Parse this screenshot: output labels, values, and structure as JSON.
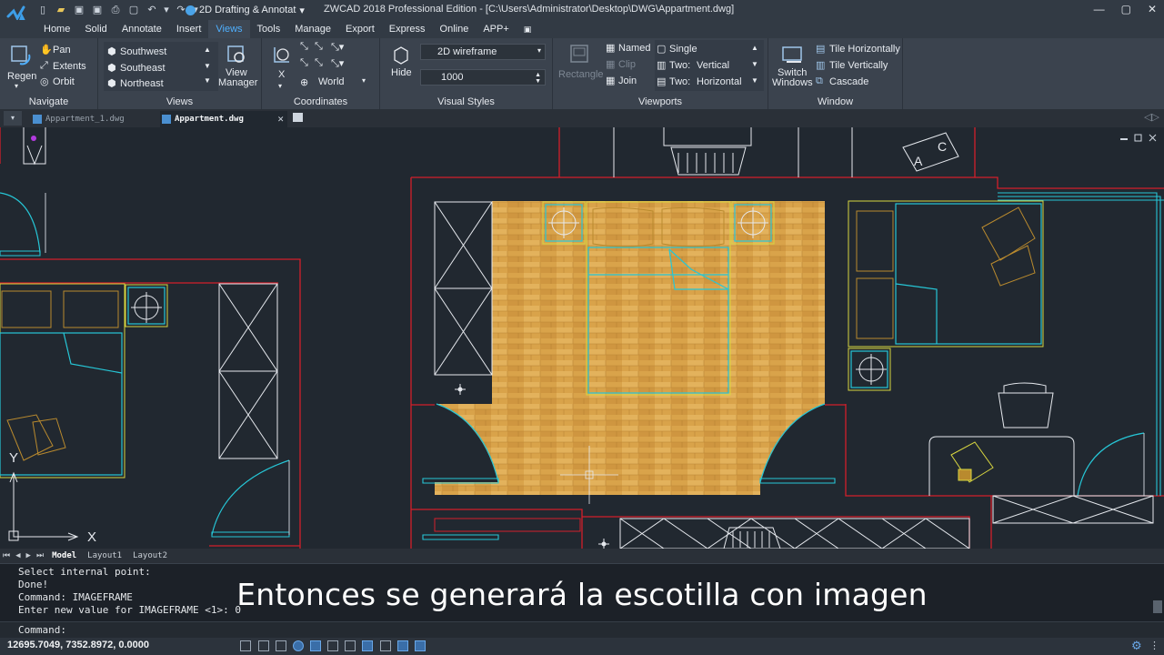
{
  "app": {
    "window_title": "ZWCAD 2018 Professional Edition - [C:\\Users\\Administrator\\Desktop\\DWG\\Appartment.dwg]",
    "workspace": "2D Drafting & Annotat"
  },
  "menu": {
    "tabs": [
      "Home",
      "Solid",
      "Annotate",
      "Insert",
      "Views",
      "Tools",
      "Manage",
      "Export",
      "Express",
      "Online",
      "APP+"
    ],
    "active": "Views"
  },
  "ribbon": {
    "navigate": {
      "title": "Navigate",
      "regen": "Regen",
      "pan": "Pan",
      "extents": "Extents",
      "orbit": "Orbit"
    },
    "views": {
      "title": "Views",
      "items": [
        "Southwest",
        "Southeast",
        "Northeast"
      ],
      "view_manager_1": "View",
      "view_manager_2": "Manager"
    },
    "coordinates": {
      "title": "Coordinates",
      "x_label": "X",
      "world": "World"
    },
    "visual_styles": {
      "title": "Visual Styles",
      "hide": "Hide",
      "style": "2D wireframe",
      "value": "1000"
    },
    "viewports": {
      "title": "Viewports",
      "rectangle": "Rectangle",
      "named": "Named",
      "clip": "Clip",
      "join": "Join",
      "single": "Single",
      "two_label_1": "Two:",
      "two_value_1": "Vertical",
      "two_label_2": "Two:",
      "two_value_2": "Horizontal"
    },
    "window": {
      "title": "Window",
      "switch_1": "Switch",
      "switch_2": "Windows",
      "tile_h": "Tile Horizontally",
      "tile_v": "Tile Vertically",
      "cascade": "Cascade"
    }
  },
  "doc_tabs": [
    "Appartment_1.dwg",
    "Appartment.dwg"
  ],
  "active_doc": "Appartment.dwg",
  "layout_tabs": [
    "Model",
    "Layout1",
    "Layout2"
  ],
  "command": {
    "history": [
      "Select internal point:",
      "Done!",
      "Command: IMAGEFRAME",
      "Enter new value for IMAGEFRAME <1>: 0"
    ],
    "prompt": "Command:"
  },
  "subtitle": "Entonces se generará la escotilla con imagen",
  "status": {
    "coordinates": "12695.7049, 7352.8972, 0.0000"
  },
  "drawing": {
    "ucs_x": "X",
    "ucs_y": "Y",
    "tag_a": "A",
    "tag_c": "C"
  },
  "colors": {
    "accent": "#4fb0ff",
    "wall": "#d21f2b",
    "cyan": "#26c6d6",
    "yellow": "#d8d640",
    "wood": "#d9a34a"
  }
}
